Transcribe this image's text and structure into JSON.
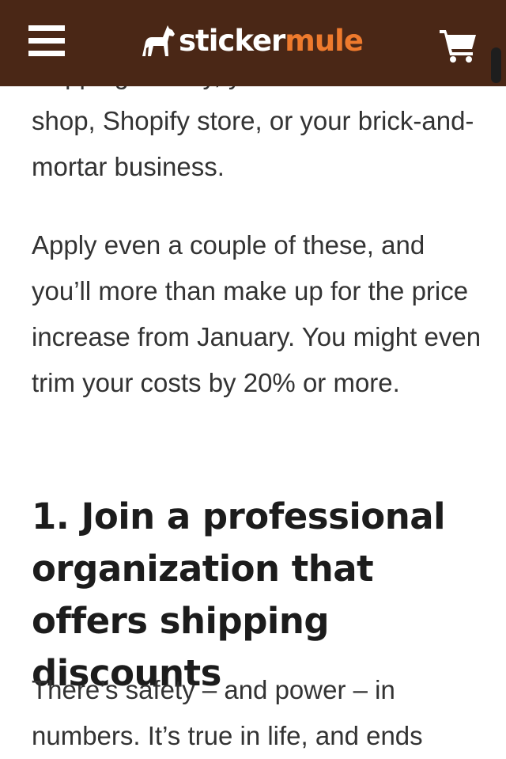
{
  "header": {
    "logo_part1": "sticker",
    "logo_part2": "mule",
    "menu_icon": "hamburger-menu-icon",
    "cart_icon": "shopping-cart-icon",
    "background_color": "#4a2716",
    "accent_color": "#ee7a2d"
  },
  "article": {
    "clipped_line": "shipping to Etsy, your",
    "para1": "shop, Shopify store, or your brick-and-mortar business.",
    "para2": "Apply even a couple of these, and you’ll more than make up for the price increase from January. You might even trim your costs by 20% or more.",
    "heading": "1. Join a professional organization that offers shipping discounts",
    "para3": "There’s safety – and power – in numbers. It’s true in life, and ends"
  }
}
